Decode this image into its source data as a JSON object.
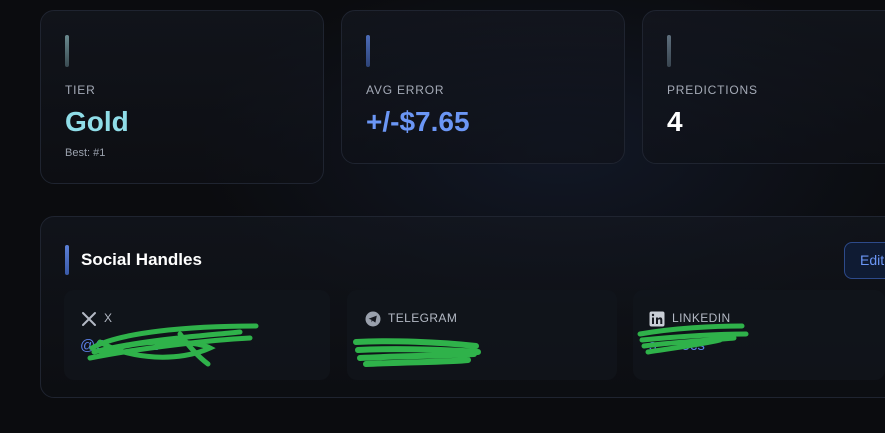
{
  "stats": {
    "tier": {
      "label": "TIER",
      "value": "Gold",
      "sub": "Best: #1",
      "accent_color": "#5fd3e3"
    },
    "avg_error": {
      "label": "AVG ERROR",
      "value": "+/-$7.65",
      "accent_color": "#6b96f5"
    },
    "predictions": {
      "label": "PREDICTIONS",
      "value": "4",
      "accent_color": "#ffffff"
    }
  },
  "social": {
    "title": "Social Handles",
    "edit_label": "Edit",
    "handles": [
      {
        "platform": "X",
        "icon": "x-icon",
        "value": "@C           3"
      },
      {
        "platform": "TELEGRAM",
        "icon": "telegram-icon",
        "value": ""
      },
      {
        "platform": "LINKEDIN",
        "icon": "linkedin-icon",
        "value": "s      ocs"
      }
    ],
    "redaction_color": "#2fb24a"
  }
}
